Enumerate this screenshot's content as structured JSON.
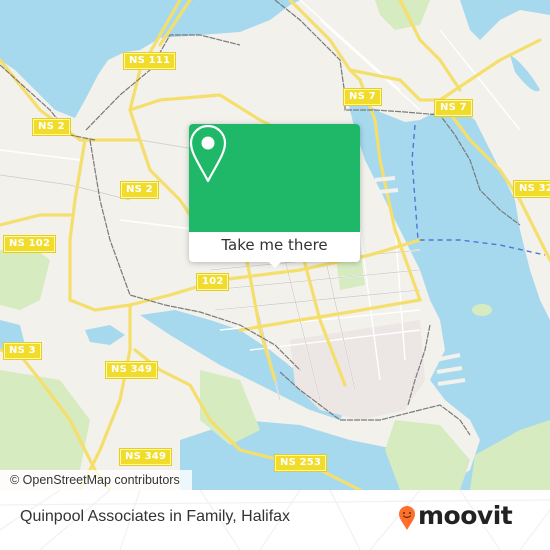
{
  "map": {
    "colors": {
      "water": "#a7d9ee",
      "land": "#f2f1ec",
      "park": "#d6ebc0",
      "road_major": "#f5df6c",
      "rail": "#777777",
      "ferry": "#4a78d8"
    },
    "road_labels": [
      {
        "id": "ns111",
        "text": "NS 111"
      },
      {
        "id": "ns2-west",
        "text": "NS 2"
      },
      {
        "id": "ns2-center",
        "text": "NS  2"
      },
      {
        "id": "ns7-west",
        "text": "NS 7"
      },
      {
        "id": "ns7-east",
        "text": "NS 7"
      },
      {
        "id": "ns32",
        "text": "NS 32"
      },
      {
        "id": "ns102",
        "text": "NS 102"
      },
      {
        "id": "r102",
        "text": "102"
      },
      {
        "id": "ns3",
        "text": "NS 3"
      },
      {
        "id": "ns349-north",
        "text": "NS 349"
      },
      {
        "id": "ns349-south",
        "text": "NS 349"
      },
      {
        "id": "ns253",
        "text": "NS 253"
      }
    ],
    "attribution": "© OpenStreetMap contributors"
  },
  "popup": {
    "pin_icon": "map-pin-icon",
    "cta_label": "Take me there",
    "accent": "#1eb868"
  },
  "footer": {
    "place_name": "Quinpool Associates in Family, Halifax",
    "logo_text": "moovit",
    "logo_accent": "#ff6f2c"
  }
}
